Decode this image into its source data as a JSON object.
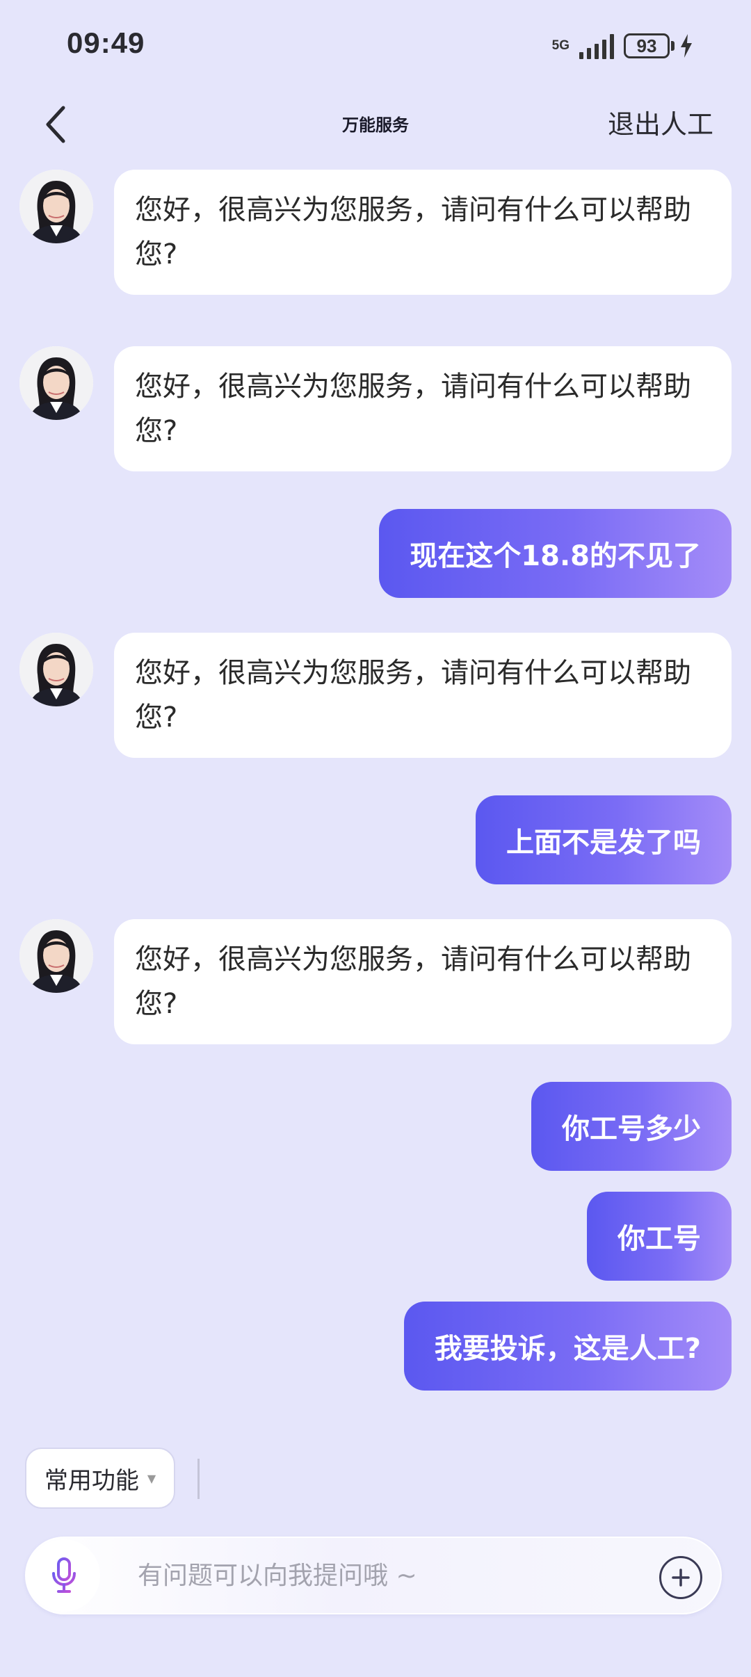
{
  "status_bar": {
    "time": "09:49",
    "network": "5G",
    "battery": "93"
  },
  "header": {
    "title": "万能服务",
    "exit_label": "退出人工"
  },
  "messages": [
    {
      "role": "agent",
      "text": "您好，很高兴为您服务，请问有什么可以帮助您?"
    },
    {
      "role": "agent",
      "text": "您好，很高兴为您服务，请问有什么可以帮助您?"
    },
    {
      "role": "user",
      "text": "现在这个18.8的不见了"
    },
    {
      "role": "agent",
      "text": "您好，很高兴为您服务，请问有什么可以帮助您?"
    },
    {
      "role": "user",
      "text": "上面不是发了吗"
    },
    {
      "role": "agent",
      "text": "您好，很高兴为您服务，请问有什么可以帮助您?"
    },
    {
      "role": "user",
      "text": "你工号多少"
    },
    {
      "role": "user",
      "text": "你工号"
    },
    {
      "role": "user",
      "text": "我要投诉，这是人工?"
    }
  ],
  "quick_functions": {
    "label": "常用功能"
  },
  "input": {
    "placeholder": "有问题可以向我提问哦 ~",
    "value": ""
  },
  "icons": {
    "back": "chevron-left-icon",
    "mic": "microphone-icon",
    "add": "plus-circle-icon"
  },
  "colors": {
    "background": "#e5e5fb",
    "user_bubble_start": "#5b58f0",
    "user_bubble_end": "#a48cf8",
    "agent_bubble": "#ffffff"
  }
}
